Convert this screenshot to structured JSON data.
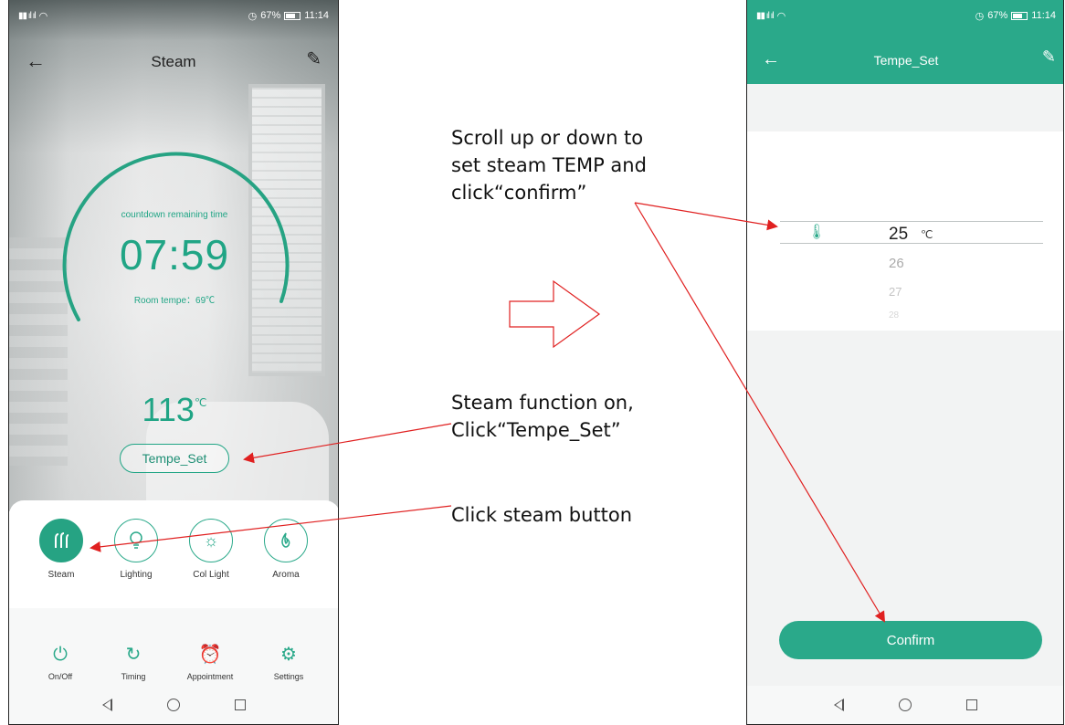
{
  "status_bar": {
    "battery": "67%",
    "time": "11:14"
  },
  "left_screen": {
    "title": "Steam",
    "countdown_label": "countdown remaining time",
    "countdown_time": "07:59",
    "room_temp": "Room tempe：69℃",
    "set_temp_value": "113",
    "set_temp_unit": "℃",
    "tempe_set_label": "Tempe_Set",
    "functions": [
      {
        "label": "Steam",
        "icon": "steam-icon",
        "active": true
      },
      {
        "label": "Lighting",
        "icon": "bulb-icon",
        "active": false
      },
      {
        "label": "Col Light",
        "icon": "sun-icon",
        "active": false
      },
      {
        "label": "Aroma",
        "icon": "flame-icon",
        "active": false
      }
    ],
    "controls": [
      {
        "label": "On/Off",
        "icon": "power-icon"
      },
      {
        "label": "Timing",
        "icon": "timer-icon"
      },
      {
        "label": "Appointment",
        "icon": "alarm-clock-icon"
      },
      {
        "label": "Settings",
        "icon": "gear-icon"
      }
    ]
  },
  "right_screen": {
    "title": "Tempe_Set",
    "selected_value": "25",
    "unit": "℃",
    "next_values": [
      "26",
      "27",
      "28"
    ],
    "confirm_label": "Confirm"
  },
  "annotations": {
    "note_temp_line1": "Scroll up or down to",
    "note_temp_line2": "set steam TEMP and",
    "note_temp_line3": "click“confirm”",
    "note_tempset_line1": " Steam function on,",
    "note_tempset_line2": "Click“Tempe_Set”",
    "note_steam": "Click steam button",
    "arrow_color": "#e02020",
    "accent_color": "#2aa98a"
  }
}
